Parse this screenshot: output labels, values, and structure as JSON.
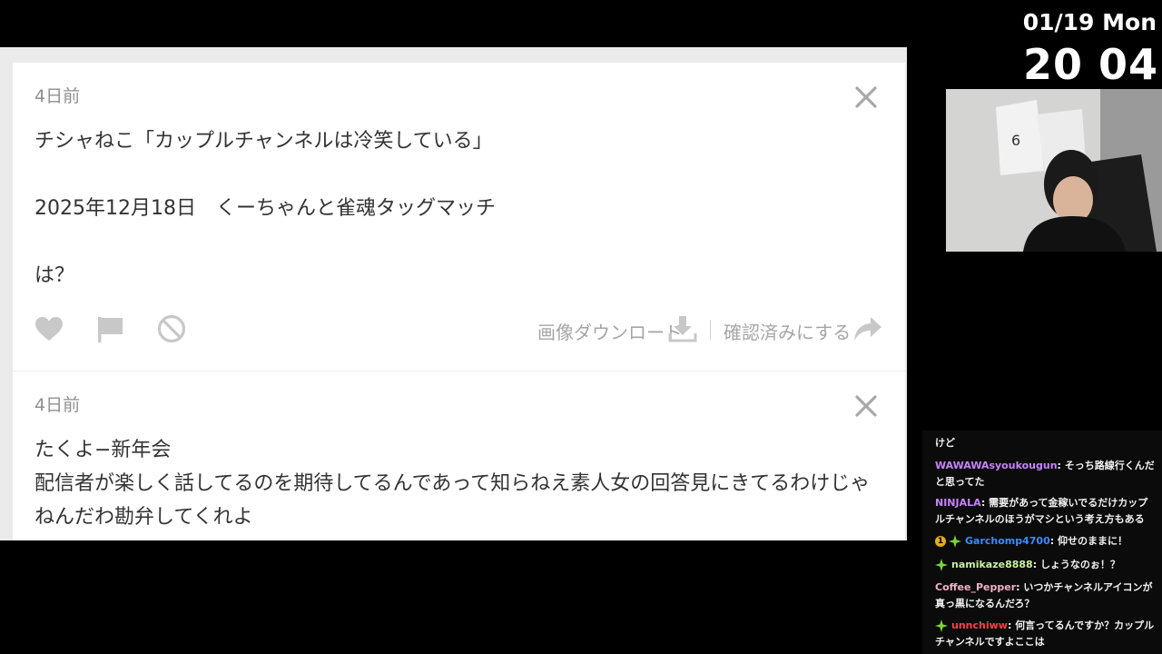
{
  "clock": {
    "date": "01/19 Mon",
    "time": "20 04"
  },
  "questions": [
    {
      "time": "4日前",
      "body": "チシャねこ「カップルチャンネルは冷笑している」\n\n2025年12月18日　くーちゃんと雀魂タッグマッチ\n\nは？",
      "download_label": "画像ダウンロード",
      "check_label": "確認済みにする"
    },
    {
      "time": "4日前",
      "body": "たくよ−新年会\n配信者が楽しく話してるのを期待してるんであって知らねえ素人女の回答見にきてるわけじゃねんだわ勘弁してくれよ"
    }
  ],
  "chat": {
    "messages": [
      {
        "user": "",
        "text": "けど",
        "color": "#e05050"
      },
      {
        "user": "WAWAWAsyoukougun",
        "text": "そっち路線行くんだと思ってた",
        "color": "#c882ff"
      },
      {
        "user": "NINJALA",
        "text": "需要があって金稼いでるだけカップルチャンネルのほうがマシという考え方もある",
        "color": "#c882ff"
      },
      {
        "user": "Garchomp4700",
        "text": "仰せのままに！",
        "color": "#3b8bff",
        "badge_sub": "1",
        "badge_star": true
      },
      {
        "user": "namikaze8888",
        "text": "しょうなのぉ！？",
        "color": "#c8f0a0",
        "badge_star": true
      },
      {
        "user": "Coffee_Pepper",
        "text": "いつかチャンネルアイコンが真っ黒になるんだろ？",
        "color": "#f0b0c8"
      },
      {
        "user": "unnchiww",
        "text": "何言ってるんですか？カップルチャンネルですよここは",
        "color": "#ff4040",
        "badge_star": true
      }
    ]
  },
  "colors": {
    "panel_bg": "#ebebeb",
    "card_bg": "#ffffff",
    "muted": "#a6a6a6",
    "chat_bg": "#0b0b0b"
  }
}
